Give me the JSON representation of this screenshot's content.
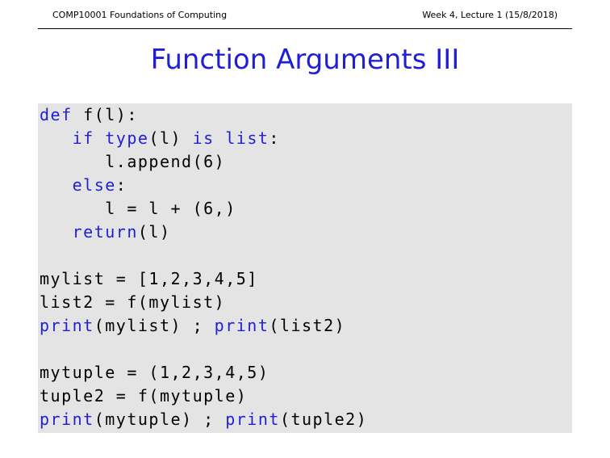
{
  "header": {
    "left": "COMP10001 Foundations of Computing",
    "right": "Week 4, Lecture 1 (15/8/2018)"
  },
  "slide": {
    "title": "Function Arguments III"
  },
  "code": {
    "lines": [
      [
        {
          "t": "def",
          "k": true
        },
        {
          "t": " f(l):",
          "k": false
        }
      ],
      [
        {
          "t": "   ",
          "k": false
        },
        {
          "t": "if",
          "k": true
        },
        {
          "t": " ",
          "k": false
        },
        {
          "t": "type",
          "k": true
        },
        {
          "t": "(l) ",
          "k": false
        },
        {
          "t": "is",
          "k": true
        },
        {
          "t": " ",
          "k": false
        },
        {
          "t": "list",
          "k": true
        },
        {
          "t": ":",
          "k": false
        }
      ],
      [
        {
          "t": "      l.append(6)",
          "k": false
        }
      ],
      [
        {
          "t": "   ",
          "k": false
        },
        {
          "t": "else",
          "k": true
        },
        {
          "t": ":",
          "k": false
        }
      ],
      [
        {
          "t": "      l = l + (6,)",
          "k": false
        }
      ],
      [
        {
          "t": "   ",
          "k": false
        },
        {
          "t": "return",
          "k": true
        },
        {
          "t": "(l)",
          "k": false
        }
      ],
      [],
      [
        {
          "t": "mylist = [1,2,3,4,5]",
          "k": false
        }
      ],
      [
        {
          "t": "list2 = f(mylist)",
          "k": false
        }
      ],
      [
        {
          "t": "print",
          "k": true
        },
        {
          "t": "(mylist) ; ",
          "k": false
        },
        {
          "t": "print",
          "k": true
        },
        {
          "t": "(list2)",
          "k": false
        }
      ],
      [],
      [
        {
          "t": "mytuple = (1,2,3,4,5)",
          "k": false
        }
      ],
      [
        {
          "t": "tuple2 = f(mytuple)",
          "k": false
        }
      ],
      [
        {
          "t": "print",
          "k": true
        },
        {
          "t": "(mytuple) ; ",
          "k": false
        },
        {
          "t": "print",
          "k": true
        },
        {
          "t": "(tuple2)",
          "k": false
        }
      ]
    ]
  }
}
